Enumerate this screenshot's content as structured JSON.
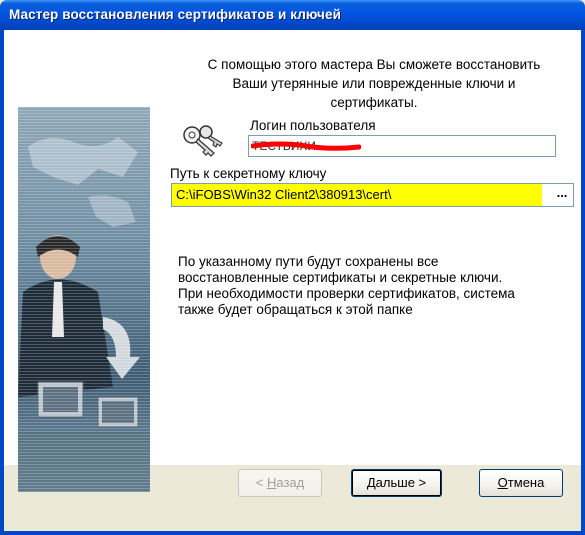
{
  "window": {
    "title": "Мастер восстановления сертификатов и ключей"
  },
  "intro": {
    "line1": "С помощью этого мастера Вы сможете восстановить",
    "line2": "Ваши утерянные или поврежденные ключи и",
    "line3": "сертификаты."
  },
  "login": {
    "label": "Логин пользователя",
    "value": "ТЕСТЬИХИ"
  },
  "path": {
    "label": "Путь к секретному ключу",
    "value": "C:\\iFOBS\\Win32 Client2\\380913\\cert\\",
    "browse_label": "..."
  },
  "note": {
    "line1": "По указанному пути будут сохранены все",
    "line2": "восстановленные сертификаты и секретные ключи.",
    "line3": "При необходимости проверки сертификатов, система",
    "line4": "также будет обращаться к этой папке"
  },
  "buttons": {
    "back_prefix": "< ",
    "back_hotkey": "Н",
    "back_rest": "азад",
    "next_hotkey": "Д",
    "next_rest": "альше >",
    "cancel_hotkey": "О",
    "cancel_rest": "тмена"
  },
  "colors": {
    "title_blue": "#0054e3",
    "path_highlight": "#ffff00",
    "redaction": "#ff0000"
  }
}
